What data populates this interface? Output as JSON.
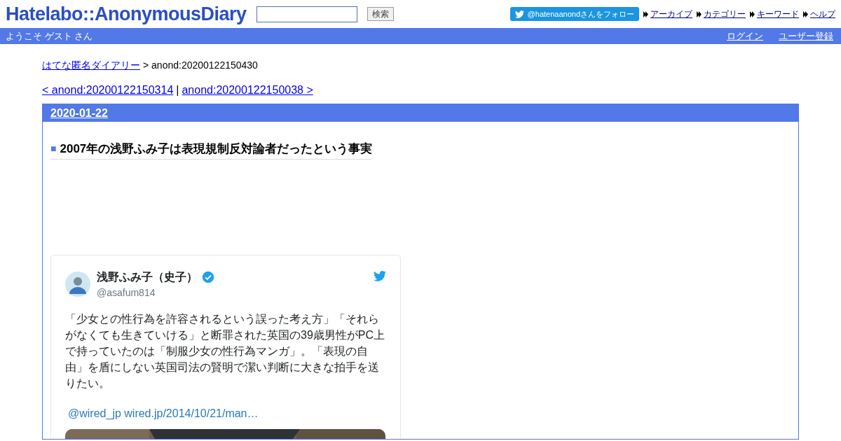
{
  "header": {
    "logo": "Hatelabo::AnonymousDiary",
    "search_button": "検索",
    "follow_button": "@hatenaanondさんをフォロー",
    "nav_links": [
      "アーカイブ",
      "カテゴリー",
      "キーワード",
      "ヘルプ"
    ]
  },
  "user_bar": {
    "greeting": "ようこそ ゲスト さん",
    "links": [
      "ログイン",
      "ユーザー登録"
    ]
  },
  "breadcrumb": {
    "link": "はてな匿名ダイアリー",
    "current": "> anond:20200122150430"
  },
  "pager": {
    "prev": "< anond:20200122150314",
    "separator": "|",
    "next": "anond:20200122150038 >"
  },
  "day": {
    "date": "2020-01-22",
    "entry": {
      "marker": "■",
      "title": "2007年の浅野ふみ子は表現規制反対論者だったという事実",
      "tweet": {
        "name": "浅野ふみ子（史子）",
        "verified": true,
        "handle": "@asafum814",
        "text": "「少女との性行為を許容されるという誤った考え方」「それらがなくても生きていける」と断罪された英国の39歳男性がPC上で持っていたのは「制服少女の性行為マンガ」。「表現の自由」を盾にしない英国司法の賢明で潔い判断に大きな拍手を送りたい。",
        "link": "@wired_jp wired.jp/2014/10/21/man…"
      }
    }
  }
}
